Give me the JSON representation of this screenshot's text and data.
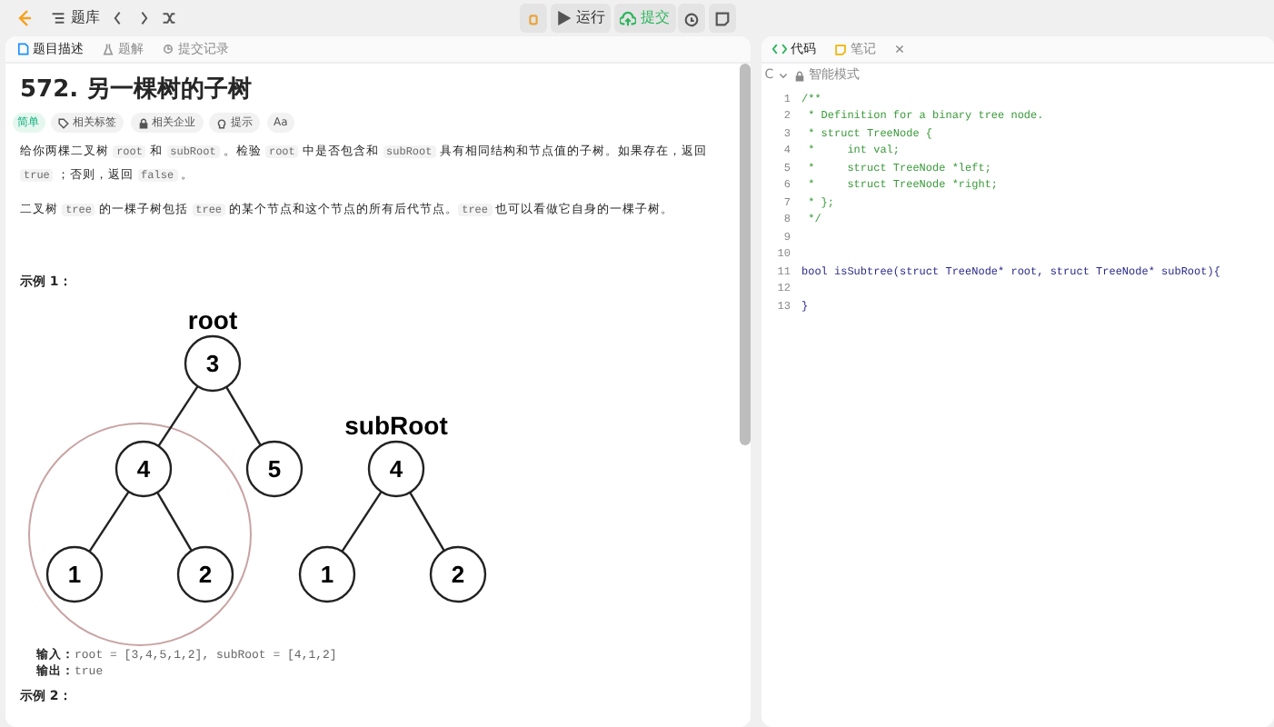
{
  "topbar": {
    "problem_list": "题库",
    "run_button": "运行",
    "submit_button": "提交"
  },
  "left_tabs": [
    {
      "label": "题目描述",
      "selected": true
    },
    {
      "label": "题解",
      "selected": false
    },
    {
      "label": "提交记录",
      "selected": false
    }
  ],
  "problem": {
    "title": "572. 另一棵树的子树",
    "difficulty": "简单",
    "tags": [
      "相关标签",
      "相关企业",
      "提示",
      "Aa"
    ],
    "paragraphs": [
      [
        {
          "text": "给你两棵二叉树 ",
          "code": false
        },
        {
          "text": "root",
          "code": true
        },
        {
          "text": " 和 ",
          "code": false
        },
        {
          "text": "subRoot",
          "code": true
        },
        {
          "text": " 。检验 ",
          "code": false
        },
        {
          "text": "root",
          "code": true
        },
        {
          "text": " 中是否包含和 ",
          "code": false
        },
        {
          "text": "subRoot",
          "code": true
        },
        {
          "text": " 具有相同结构和节点值的子树。如果存在，返回 ",
          "code": false
        },
        {
          "text": "true",
          "code": true
        },
        {
          "text": " ；否则，返回 ",
          "code": false
        },
        {
          "text": "false",
          "code": true
        },
        {
          "text": " 。",
          "code": false
        }
      ],
      [
        {
          "text": "二叉树 ",
          "code": false
        },
        {
          "text": "tree",
          "code": true
        },
        {
          "text": " 的一棵子树包括 ",
          "code": false
        },
        {
          "text": "tree",
          "code": true
        },
        {
          "text": " 的某个节点和这个节点的所有后代节点。",
          "code": false
        },
        {
          "text": "tree",
          "code": true
        },
        {
          "text": " 也可以看做它自身的一棵子树。",
          "code": false
        }
      ]
    ],
    "example_title": "示例 1：",
    "trees": [
      {
        "label": "root",
        "highlighted": true,
        "root": {
          "value": "3",
          "children": [
            {
              "value": "4",
              "children": [
                {
                  "value": "1"
                },
                {
                  "value": "2"
                }
              ]
            },
            {
              "value": "5"
            }
          ]
        }
      },
      {
        "label": "subRoot",
        "highlighted": false,
        "root": {
          "value": "4",
          "children": [
            {
              "value": "1"
            },
            {
              "value": "2"
            }
          ]
        }
      }
    ],
    "io": [
      {
        "label": "输入：",
        "value": "root = [3,4,5,1,2], subRoot = [4,1,2]"
      },
      {
        "label": "输出：",
        "value": "true"
      }
    ],
    "next_example": "示例 2："
  },
  "right_tabs": [
    {
      "label": "代码",
      "selected": true
    },
    {
      "label": "笔记",
      "selected": false
    }
  ],
  "editor": {
    "language": "C",
    "mode": "智能模式",
    "lines": [
      {
        "number": "1",
        "text": "/**",
        "kind": "comment"
      },
      {
        "number": "2",
        "text": " * Definition for a binary tree node.",
        "kind": "comment"
      },
      {
        "number": "3",
        "text": " * struct TreeNode {",
        "kind": "comment"
      },
      {
        "number": "4",
        "text": " *     int val;",
        "kind": "comment"
      },
      {
        "number": "5",
        "text": " *     struct TreeNode *left;",
        "kind": "comment"
      },
      {
        "number": "6",
        "text": " *     struct TreeNode *right;",
        "kind": "comment"
      },
      {
        "number": "7",
        "text": " * };",
        "kind": "comment"
      },
      {
        "number": "8",
        "text": " */",
        "kind": "comment"
      },
      {
        "number": "9",
        "kind": "blank"
      },
      {
        "number": "10",
        "kind": "blank"
      },
      {
        "number": "11",
        "text": "bool isSubtree(struct TreeNode* root, struct TreeNode* subRoot){",
        "kind": "code"
      },
      {
        "number": "12",
        "kind": "blank"
      },
      {
        "number": "13",
        "text": "}",
        "kind": "code"
      }
    ]
  }
}
